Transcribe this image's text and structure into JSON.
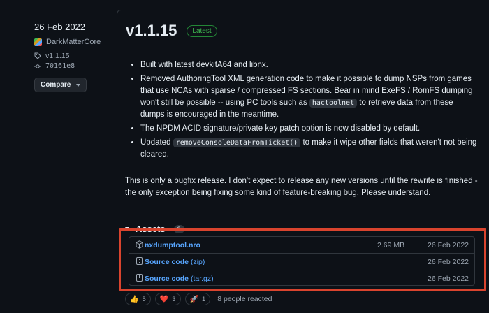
{
  "sidebar": {
    "date": "26 Feb 2022",
    "author": "DarkMatterCore",
    "tag": "v1.1.15",
    "commit": "70161e8",
    "compare_label": "Compare"
  },
  "release": {
    "version": "v1.1.15",
    "badge": "Latest",
    "notes": [
      {
        "text": "Built with latest devkitA64 and libnx."
      },
      {
        "pre": "Removed AuthoringTool XML generation code to make it possible to dump NSPs from games that use NCAs with sparse / compressed FS sections. Bear in mind ExeFS / RomFS dumping won't still be possible -- using PC tools such as ",
        "code": "hactoolnet",
        "post": " to retrieve data from these dumps is encouraged in the meantime."
      },
      {
        "text": "The NPDM ACID signature/private key patch option is now disabled by default."
      },
      {
        "pre": "Updated ",
        "code": "removeConsoleDataFromTicket()",
        "post": " to make it wipe other fields that weren't not being cleared."
      }
    ],
    "paragraph": "This is only a bugfix release. I don't expect to release any new versions until the rewrite is finished - the only exception being fixing some kind of feature-breaking bug. Please understand."
  },
  "assets": {
    "title": "Assets",
    "count": "3",
    "items": [
      {
        "name": "nxdumptool.nro",
        "ext": "",
        "size": "2.69 MB",
        "date": "26 Feb 2022"
      },
      {
        "name": "Source code",
        "ext": "(zip)",
        "size": "",
        "date": "26 Feb 2022"
      },
      {
        "name": "Source code",
        "ext": "(tar.gz)",
        "size": "",
        "date": "26 Feb 2022"
      }
    ]
  },
  "reactions": {
    "items": [
      {
        "emoji": "👍",
        "count": "5"
      },
      {
        "emoji": "❤️",
        "count": "3"
      },
      {
        "emoji": "🚀",
        "count": "1"
      }
    ],
    "summary": "8 people reacted"
  },
  "colors": {
    "background": "#0d1117",
    "link": "#58a6ff",
    "latest_badge": "#3fb950",
    "highlight_box": "#d9442e"
  }
}
